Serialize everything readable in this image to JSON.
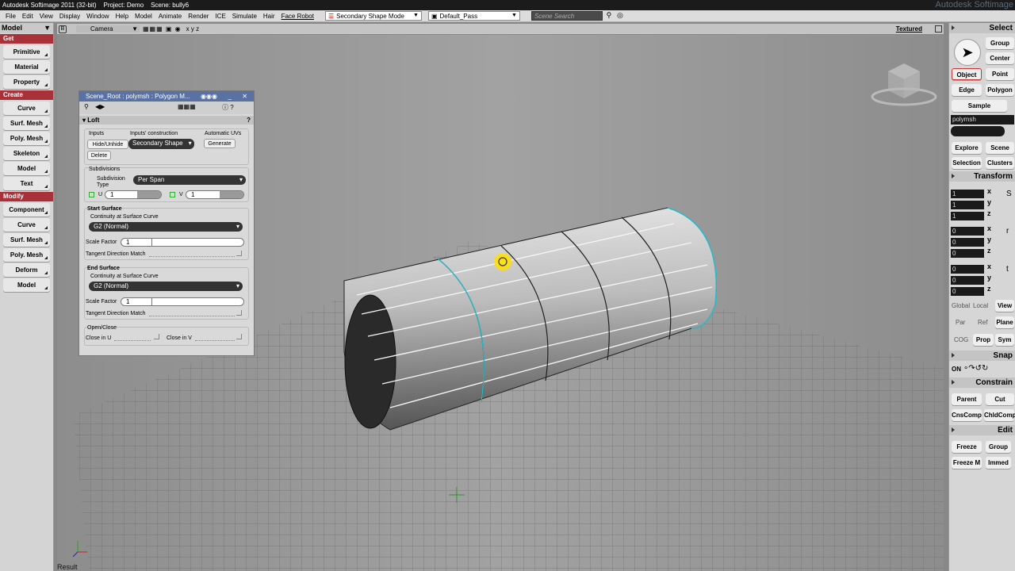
{
  "title": {
    "text": "Autodesk Softimage 2011 (32-bit)",
    "project": "Project: Demo",
    "scene": "Scene: bully6",
    "brand": "Autodesk Softimage"
  },
  "menu": [
    "File",
    "Edit",
    "View",
    "Display",
    "Window",
    "Help",
    "Model",
    "Animate",
    "Render",
    "ICE",
    "Simulate",
    "Hair",
    "Face Robot"
  ],
  "toolbar": {
    "mode": "Secondary Shape Mode",
    "pass": "Default_Pass",
    "search_placeholder": "Scene Search"
  },
  "left": {
    "model": "Model",
    "get": "Get",
    "get_items": [
      "Primitive",
      "Material",
      "Property"
    ],
    "create": "Create",
    "create_items": [
      "Curve",
      "Surf. Mesh",
      "Poly. Mesh",
      "Skeleton",
      "Model",
      "Text"
    ],
    "modify": "Modify",
    "modify_items": [
      "Component",
      "Curve",
      "Surf. Mesh",
      "Poly. Mesh",
      "Deform",
      "Model"
    ]
  },
  "viewport": {
    "camera": "Camera",
    "xyz": "x y z",
    "shading": "Textured",
    "result": "Result"
  },
  "dialog": {
    "title": "Scene_Root : polymsh : Polygon M...",
    "section": "Loft",
    "inputs": "Inputs",
    "hide_unhide": "Hide/Unhide",
    "delete": "Delete",
    "inputs_construction": "Inputs' construction",
    "construction_value": "Secondary Shape",
    "automatic_uvs": "Automatic UVs",
    "generate": "Generate",
    "subdivisions": "Subdivisions",
    "subdivision_type_label": "Subdivision Type",
    "subdivision_type": "Per Span",
    "u_label": "U",
    "u_value": "1",
    "v_label": "V",
    "v_value": "1",
    "start_surface": "Start Surface",
    "continuity_start": "Continuity at Surface Curve",
    "continuity_start_value": "G2 (Normal)",
    "scale_factor": "Scale Factor",
    "scale_start": "1",
    "tangent_start": "Tangent Direction Match",
    "end_surface": "End Surface",
    "continuity_end": "Continuity at Surface Curve",
    "continuity_end_value": "G2 (Normal)",
    "scale_end": "1",
    "tangent_end": "Tangent Direction Match",
    "open_close": "Open/Close",
    "close_u": "Close in U",
    "close_v": "Close in V"
  },
  "right": {
    "select": "Select",
    "group": "Group",
    "center": "Center",
    "object": "Object",
    "point": "Point",
    "edge": "Edge",
    "polygon": "Polygon",
    "sample": "Sample",
    "selection_name": "polymsh",
    "explore": "Explore",
    "scene": "Scene",
    "selection": "Selection",
    "clusters": "Clusters",
    "transform": "Transform",
    "scale_vals": [
      "1",
      "1",
      "1"
    ],
    "rot_vals": [
      "0",
      "0",
      "0"
    ],
    "trans_vals": [
      "0",
      "0",
      "0"
    ],
    "axes": [
      "x",
      "y",
      "z"
    ],
    "global": "Global",
    "local": "Local",
    "view": "View",
    "par": "Par",
    "ref": "Ref",
    "plane": "Plane",
    "cog": "COG",
    "prop": "Prop",
    "sym": "Sym",
    "snap": "Snap",
    "on": "ON",
    "constrain": "Constrain",
    "parent": "Parent",
    "cut": "Cut",
    "cnscomp": "CnsComp",
    "childcomp": "ChldComp",
    "edit": "Edit",
    "freeze": "Freeze",
    "edit_group": "Group",
    "freeze_m": "Freeze M",
    "immed": "Immed"
  }
}
